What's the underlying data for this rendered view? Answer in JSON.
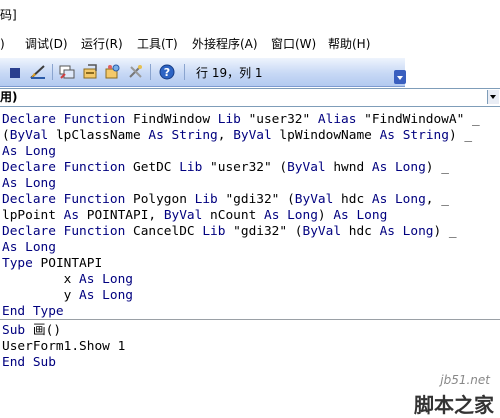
{
  "titlebar": {
    "title": "码]"
  },
  "menu": {
    "items": [
      {
        "label": ")"
      },
      {
        "label": "调试(D)"
      },
      {
        "label": "运行(R)"
      },
      {
        "label": "工具(T)"
      },
      {
        "label": "外接程序(A)"
      },
      {
        "label": "窗口(W)"
      },
      {
        "label": "帮助(H)"
      }
    ]
  },
  "toolbar": {
    "position": "行 19，列 1",
    "icons": [
      "stop-icon",
      "design-mode-icon",
      "project-explorer-icon",
      "properties-window-icon",
      "object-browser-icon",
      "toolbox-icon",
      "help-icon"
    ]
  },
  "object_combo": {
    "value": "用)"
  },
  "code": {
    "lines": [
      [
        {
          "k": 1,
          "t": "Declare Function"
        },
        {
          "t": " FindWindow "
        },
        {
          "k": 1,
          "t": "Lib"
        },
        {
          "t": " \"user32\" "
        },
        {
          "k": 1,
          "t": "Alias"
        },
        {
          "t": " \"FindWindowA\" _"
        }
      ],
      [
        {
          "t": "("
        },
        {
          "k": 1,
          "t": "ByVal"
        },
        {
          "t": " lpClassName "
        },
        {
          "k": 1,
          "t": "As String"
        },
        {
          "t": ", "
        },
        {
          "k": 1,
          "t": "ByVal"
        },
        {
          "t": " lpWindowName "
        },
        {
          "k": 1,
          "t": "As String"
        },
        {
          "t": ") _"
        }
      ],
      [
        {
          "k": 1,
          "t": "As Long"
        }
      ],
      [
        {
          "k": 1,
          "t": "Declare Function"
        },
        {
          "t": " GetDC "
        },
        {
          "k": 1,
          "t": "Lib"
        },
        {
          "t": " \"user32\" ("
        },
        {
          "k": 1,
          "t": "ByVal"
        },
        {
          "t": " hwnd "
        },
        {
          "k": 1,
          "t": "As Long"
        },
        {
          "t": ") _"
        }
      ],
      [
        {
          "k": 1,
          "t": "As Long"
        }
      ],
      [
        {
          "k": 1,
          "t": "Declare Function"
        },
        {
          "t": " Polygon "
        },
        {
          "k": 1,
          "t": "Lib"
        },
        {
          "t": " \"gdi32\" ("
        },
        {
          "k": 1,
          "t": "ByVal"
        },
        {
          "t": " hdc "
        },
        {
          "k": 1,
          "t": "As Long"
        },
        {
          "t": ", _"
        }
      ],
      [
        {
          "t": "lpPoint "
        },
        {
          "k": 1,
          "t": "As"
        },
        {
          "t": " POINTAPI, "
        },
        {
          "k": 1,
          "t": "ByVal"
        },
        {
          "t": " nCount "
        },
        {
          "k": 1,
          "t": "As Long"
        },
        {
          "t": ") "
        },
        {
          "k": 1,
          "t": "As Long"
        }
      ],
      [
        {
          "k": 1,
          "t": "Declare Function"
        },
        {
          "t": " CancelDC "
        },
        {
          "k": 1,
          "t": "Lib"
        },
        {
          "t": " \"gdi32\" ("
        },
        {
          "k": 1,
          "t": "ByVal"
        },
        {
          "t": " hdc "
        },
        {
          "k": 1,
          "t": "As Long"
        },
        {
          "t": ") _"
        }
      ],
      [
        {
          "k": 1,
          "t": "As Long"
        }
      ],
      [
        {
          "k": 1,
          "t": "Type"
        },
        {
          "t": " POINTAPI"
        }
      ],
      [
        {
          "t": "        x "
        },
        {
          "k": 1,
          "t": "As Long"
        }
      ],
      [
        {
          "t": "        y "
        },
        {
          "k": 1,
          "t": "As Long"
        }
      ],
      [
        {
          "k": 1,
          "t": "End Type"
        }
      ],
      [
        {
          "k": 1,
          "t": "Sub"
        },
        {
          "t": " 画()"
        }
      ],
      [
        {
          "t": "UserForm1.Show 1"
        }
      ],
      [
        {
          "k": 1,
          "t": "End Sub"
        }
      ]
    ]
  },
  "watermark": {
    "site": "jb51.net",
    "name": "脚本之家"
  },
  "colors": {
    "keyword": "#00007f",
    "text": "#000000",
    "toolbar": "#c7d8f5"
  }
}
